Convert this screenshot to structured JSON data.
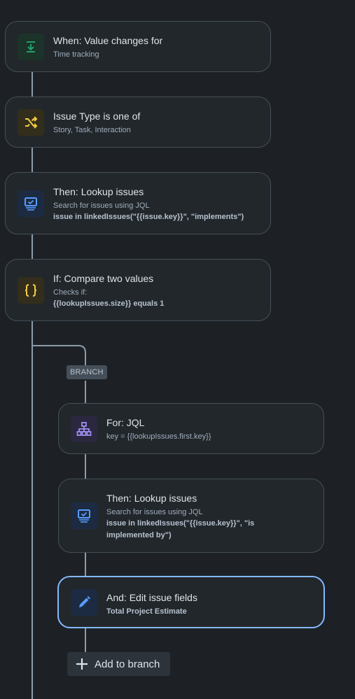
{
  "steps": [
    {
      "title": "When: Value changes for",
      "subtitle": "Time tracking"
    },
    {
      "title": "Issue Type is one of",
      "subtitle": "Story, Task, Interaction"
    },
    {
      "title": "Then: Lookup issues",
      "subtitle": "Search for issues using JQL",
      "detail": "issue in linkedIssues(\"{{issue.key}}\", \"implements\")"
    },
    {
      "title": "If: Compare two values",
      "subtitle": "Checks if:",
      "detail_bold": "{{lookupIssues.size}}",
      "detail_rest": " equals 1"
    }
  ],
  "branch": {
    "tag": "BRANCH",
    "steps": [
      {
        "title": "For: JQL",
        "subtitle": "key = {{lookupIssues.first.key}}"
      },
      {
        "title": "Then: Lookup issues",
        "subtitle": "Search for issues using JQL",
        "detail_line1": "issue in linkedIssues(\"{{issue.key}}\", \"is",
        "detail_line2": "implemented by\")"
      },
      {
        "title": "And: Edit issue fields",
        "detail": "Total Project Estimate"
      }
    ],
    "add_label": "Add to branch"
  },
  "colors": {
    "trigger_icon": "#22a06b",
    "condition_icon": "#f5cd47",
    "action_icon": "#579dff",
    "branch_icon": "#9f8fef",
    "selected_border": "#85b8ff"
  },
  "icons": {
    "trigger": "download-arrow-icon",
    "condition": "shuffle-icon",
    "lookup": "monitor-check-icon",
    "compare": "curly-braces-icon",
    "branch": "hierarchy-icon",
    "edit": "pencil-icon",
    "add": "plus-icon"
  }
}
